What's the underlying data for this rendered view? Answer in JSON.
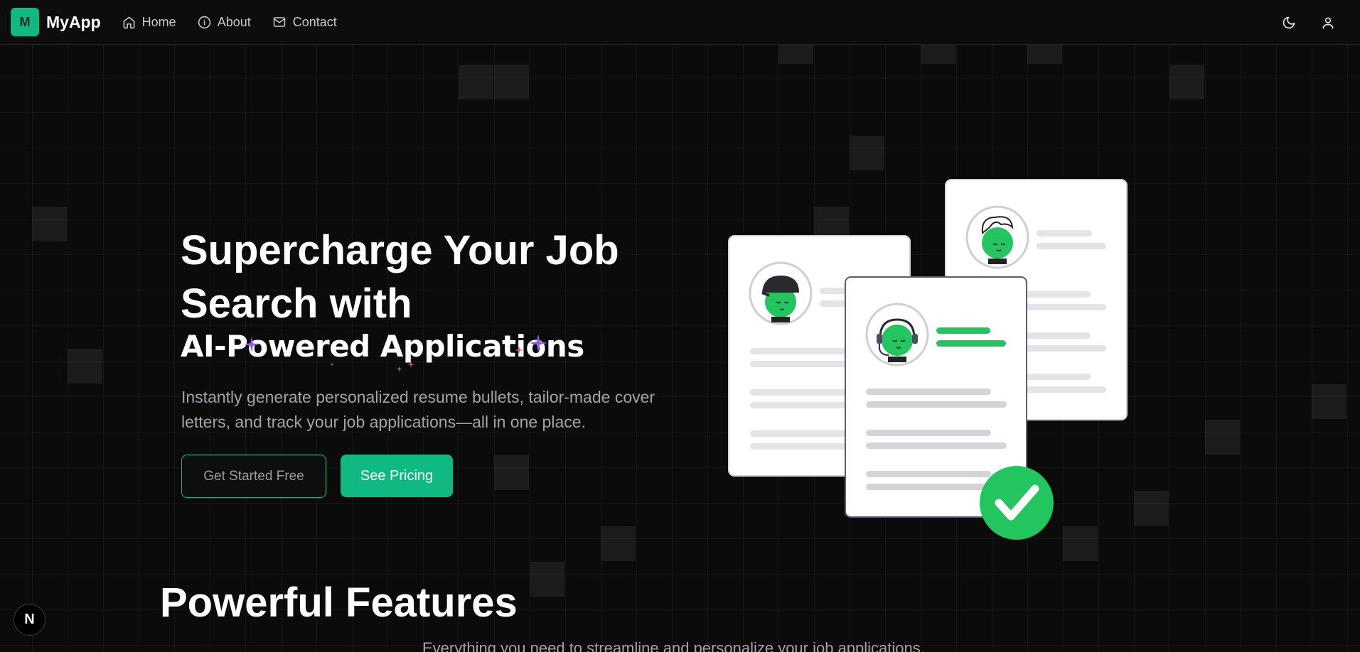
{
  "navbar": {
    "logo_letter": "M",
    "brand": "MyApp",
    "links": [
      {
        "label": "Home",
        "icon": "home-icon"
      },
      {
        "label": "About",
        "icon": "info-icon"
      },
      {
        "label": "Contact",
        "icon": "mail-icon"
      }
    ],
    "right_icons": [
      "moon-icon",
      "user-icon"
    ]
  },
  "hero": {
    "title": "Supercharge Your Job Search with",
    "subtitle": "AI-Powered Applications",
    "description": "Instantly generate personalized resume bullets, tailor-made cover letters, and track your job applications—all in one place.",
    "primary_cta": "Get Started Free",
    "secondary_cta": "See Pricing"
  },
  "features": {
    "title": "Powerful Features",
    "subtitle": "Everything you need to streamline and personalize your job applications."
  },
  "dev_badge": "N",
  "colors": {
    "accent": "#10b981",
    "background": "#0b0b0c",
    "avatar_green": "#22c55e",
    "check_green": "#22c55e"
  }
}
